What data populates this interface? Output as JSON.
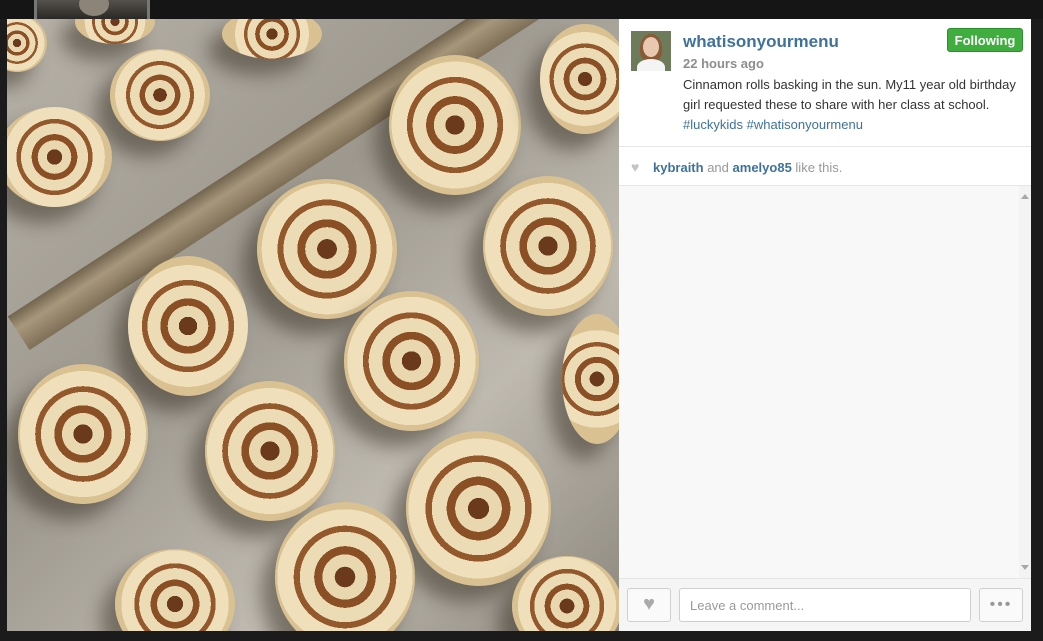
{
  "post": {
    "username": "whatisonyourmenu",
    "follow_label": "Following",
    "time_ago": "22 hours ago",
    "caption_text": "Cinnamon rolls basking in the sun. My11 year old birthday girl requested these to share with her class at school. ",
    "hashtags": [
      "#luckykids",
      "#whatisonyourmenu"
    ],
    "photo_description": "cinnamon-roll-photo"
  },
  "likes": {
    "icon": "heart-icon",
    "users": [
      "kybraith",
      "amelyo85"
    ],
    "connector": "and",
    "suffix": "like this."
  },
  "footer": {
    "like_icon": "heart-icon",
    "comment_placeholder": "Leave a comment...",
    "more_icon": "ellipsis-icon",
    "more_symbol": "•••",
    "heart_symbol": "♥"
  },
  "colors": {
    "accent_blue": "#3f729b",
    "follow_green": "#3fae3f",
    "muted": "#8e8e8e"
  }
}
